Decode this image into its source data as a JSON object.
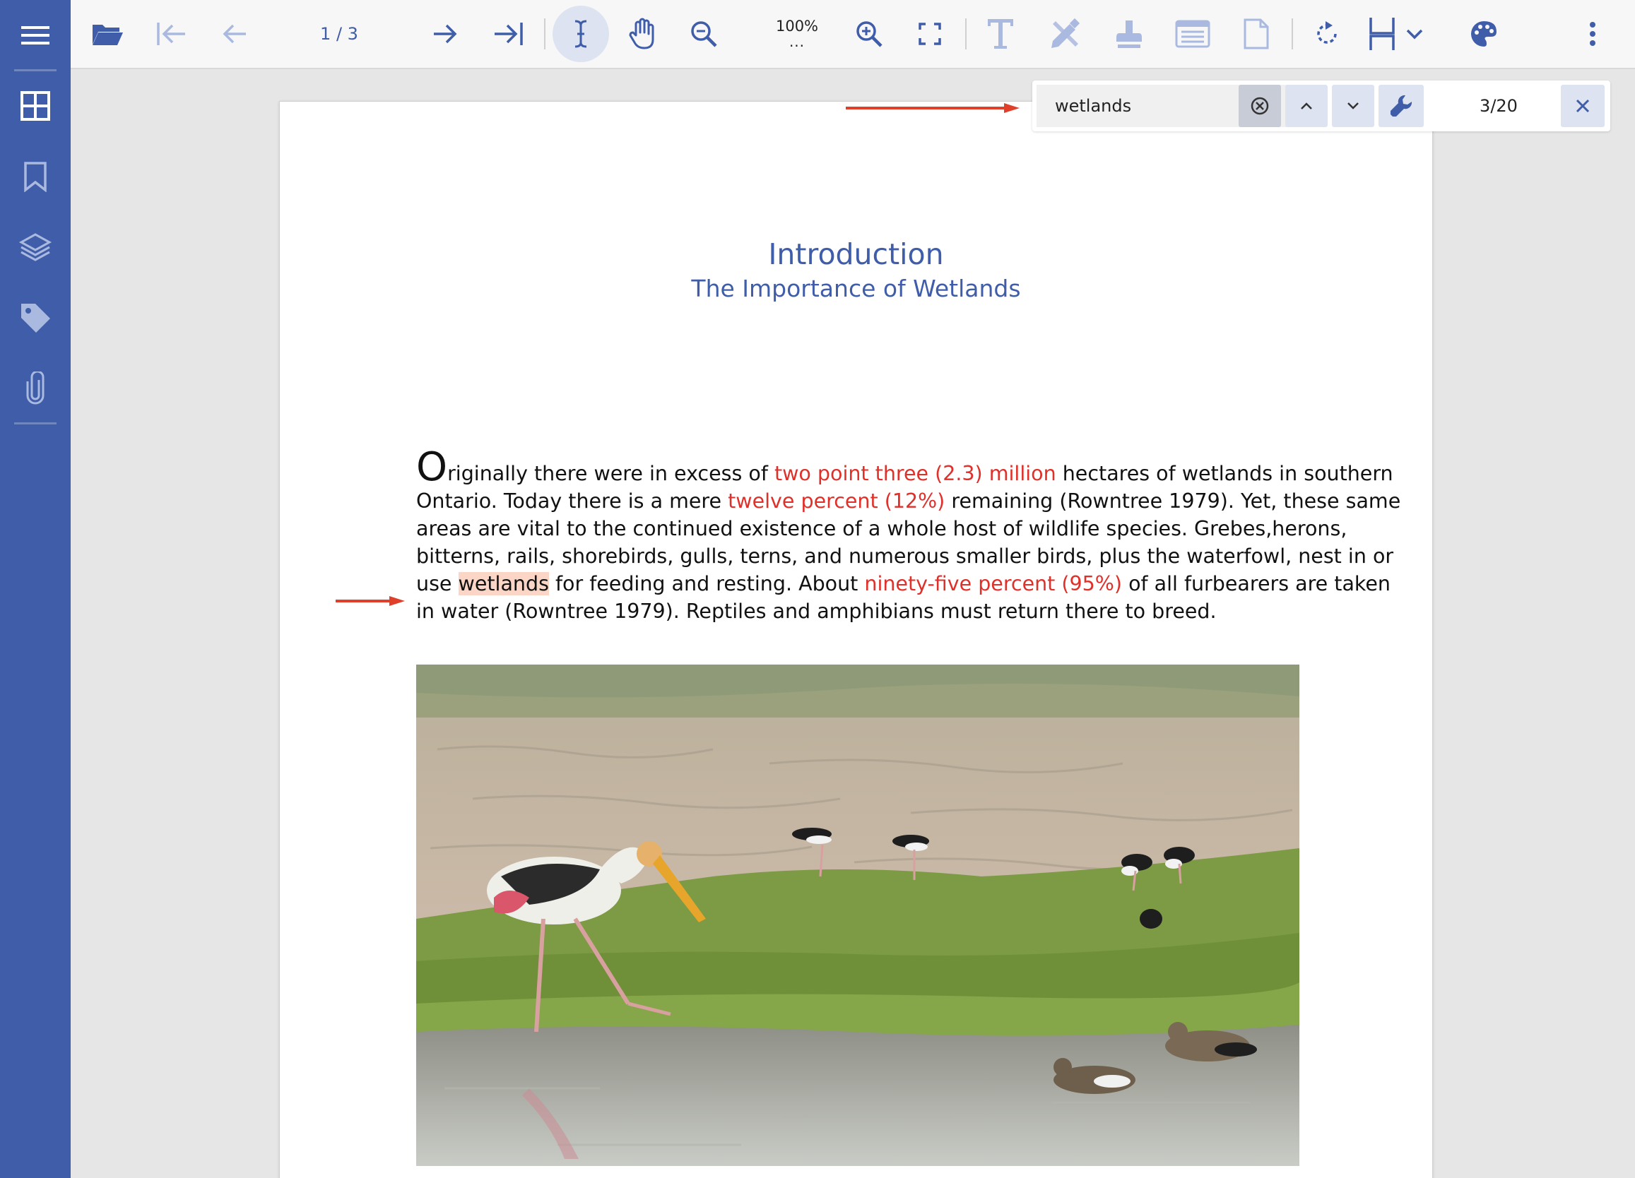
{
  "toolbar": {
    "page_indicator": "1 / 3",
    "zoom_level": "100%",
    "zoom_more": "...",
    "icons": [
      "menu-icon",
      "open-file-icon",
      "first-page-icon",
      "previous-page-icon",
      "next-page-icon",
      "last-page-icon",
      "text-select-icon",
      "pan-hand-icon",
      "zoom-out-icon",
      "zoom-in-icon",
      "fit-page-icon",
      "text-annotation-icon",
      "edit-annotation-icon",
      "stamp-icon",
      "form-field-icon",
      "page-icon",
      "rotate-icon",
      "layout-icon",
      "chevron-down-icon",
      "theme-palette-icon",
      "more-vertical-icon"
    ]
  },
  "sidebar": {
    "items": [
      {
        "icon": "thumbnails-icon"
      },
      {
        "icon": "bookmark-icon"
      },
      {
        "icon": "layers-icon"
      },
      {
        "icon": "tag-icon"
      },
      {
        "icon": "attachment-icon"
      }
    ]
  },
  "find": {
    "query": "wetlands",
    "match_count": "3/20",
    "icons": [
      "clear-search-icon",
      "previous-match-icon",
      "next-match-icon",
      "search-options-icon",
      "close-find-icon"
    ]
  },
  "document": {
    "title": "Introduction",
    "subtitle": "The Importance of Wetlands",
    "paragraph": {
      "l1_drop": "O",
      "l1_a": "riginally there were in excess of ",
      "l1_red": "two point three (2.3) million",
      "l1_b": " hectares of wetlands in southern",
      "l2_a": "Ontario. Today there is a mere ",
      "l2_red": "twelve percent (12%)",
      "l2_b": " remaining (Rowntree 1979). Yet, these same",
      "l3": "areas are vital to the continued existence of a whole host of wildlife species. Grebes,herons,",
      "l4": "bitterns, rails, shorebirds, gulls, terns, and numerous smaller birds, plus the waterfowl, nest in or",
      "l5_a": "use ",
      "l5_hit": "wetlands",
      "l5_b": " for feeding and resting. About ",
      "l5_red": "ninety-five percent (95%)",
      "l5_c": " of all furbearers are taken",
      "l6": "in water (Rowntree 1979). Reptiles and amphibians must return there to breed."
    }
  },
  "colors": {
    "sidebar": "#3f5da8",
    "accent": "#3f5da8",
    "highlight": "#fbd6c6",
    "red_text": "#e0302a",
    "annotation_arrow": "#e0402a"
  }
}
